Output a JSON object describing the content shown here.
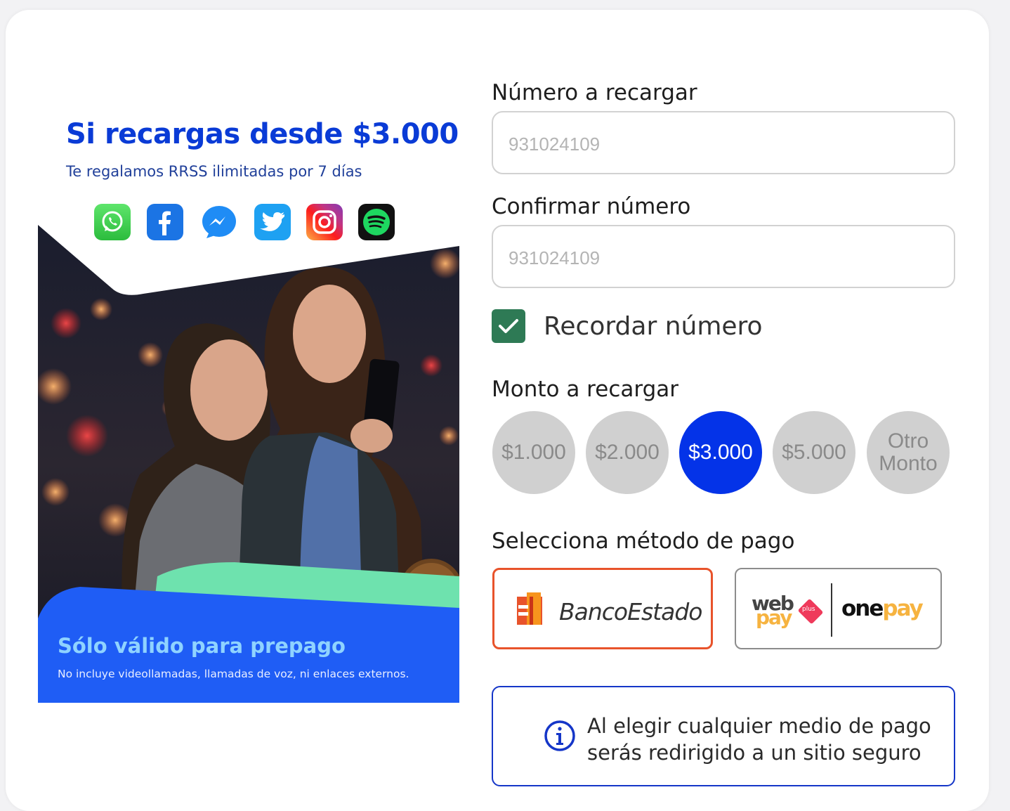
{
  "promo": {
    "title": "Si recargas desde $3.000",
    "subtitle": "Te regalamos RRSS ilimitadas por 7 días",
    "social_icons": [
      "whatsapp-icon",
      "facebook-icon",
      "messenger-icon",
      "twitter-icon",
      "instagram-icon",
      "spotify-icon"
    ],
    "footer_title": "Sólo válido para prepago",
    "footer_note": "No incluye videollamadas, llamadas de voz, ni enlaces externos."
  },
  "form": {
    "phone_label": "Número a recargar",
    "phone_placeholder": "931024109",
    "confirm_label": "Confirmar número",
    "confirm_placeholder": "931024109",
    "remember_label": "Recordar número",
    "remember_checked": true,
    "amount_label": "Monto a recargar",
    "amounts": [
      {
        "label": "$1.000",
        "selected": false
      },
      {
        "label": "$2.000",
        "selected": false
      },
      {
        "label": "$3.000",
        "selected": true
      },
      {
        "label": "$5.000",
        "selected": false
      },
      {
        "label": "Otro Monto",
        "line1": "Otro",
        "line2": "Monto",
        "selected": false
      }
    ],
    "payment_label": "Selecciona método de pago",
    "payment_methods": [
      {
        "name": "BancoEstado",
        "selected": true
      },
      {
        "name": "webpay onepay",
        "part1": "web",
        "part2": "pay",
        "badge": "plus",
        "part3": "one",
        "part4": "pay",
        "selected": false
      }
    ],
    "info_text": "Al elegir cualquier medio de pago serás redirigido a un sitio seguro"
  },
  "colors": {
    "brand_blue": "#0433e8",
    "checkbox_green": "#2e7a55",
    "selected_payment_border": "#e8532b",
    "info_border": "#1536c8"
  }
}
